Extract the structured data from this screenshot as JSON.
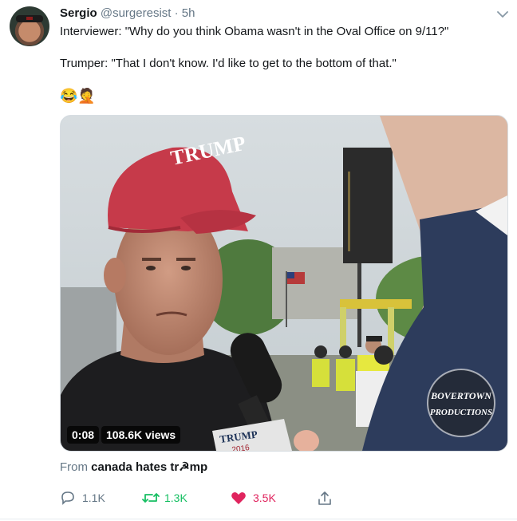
{
  "tweet": {
    "author_name": "Sergio",
    "author_handle": "@surgeresist",
    "separator": "·",
    "time": "5h",
    "line1": "Interviewer: \"Why do you think Obama wasn't in the Oval Office on 9/11?\"",
    "line2": "Trumper: \"That I don't know. I'd like to get to the bottom of that.\"",
    "emoji": "😂🤦"
  },
  "media": {
    "hat_text": "TRUMP",
    "mic_text": "TRUMP",
    "mic_year": "2016",
    "watermark_line1": "BOVERTOWN",
    "watermark_line2": "PRODUCTIONS",
    "timestamp": "0:08",
    "views": "108.6K views"
  },
  "source": {
    "prefix": "From",
    "name": "canada hates tr☭mp"
  },
  "actions": {
    "replies": "1.1K",
    "retweets": "1.3K",
    "likes": "3.5K"
  },
  "colors": {
    "text": "#14171a",
    "secondary": "#657786",
    "retweet": "#17bf63",
    "like": "#e0245e"
  },
  "icons": [
    "chevron-down-icon",
    "reply-icon",
    "retweet-icon",
    "heart-icon",
    "share-icon"
  ]
}
